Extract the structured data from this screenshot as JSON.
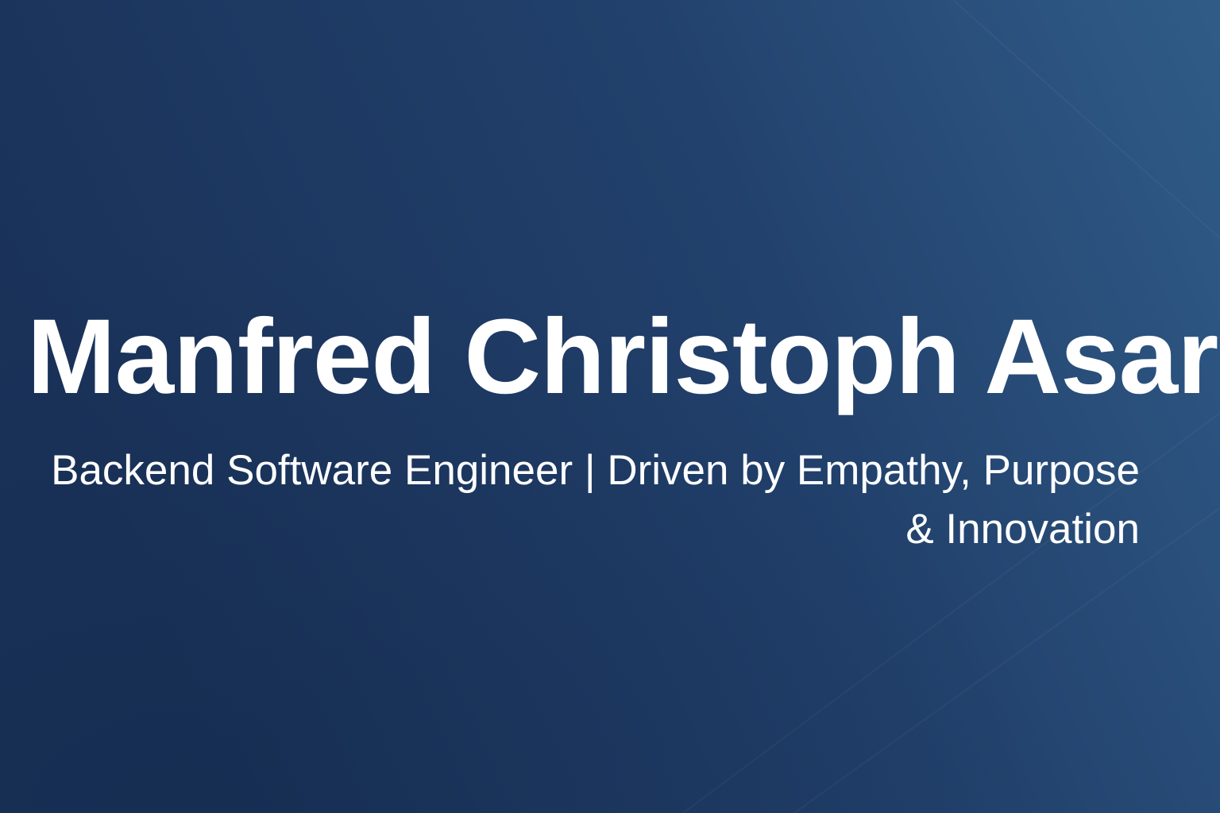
{
  "banner": {
    "name": "Manfred Christoph Asare",
    "tagline": "Backend Software Engineer | Driven by Empathy, Purpose & Innovation"
  },
  "colors": {
    "background_dark": "#1a3259",
    "background_light": "#2f5b87",
    "text": "#ffffff"
  }
}
